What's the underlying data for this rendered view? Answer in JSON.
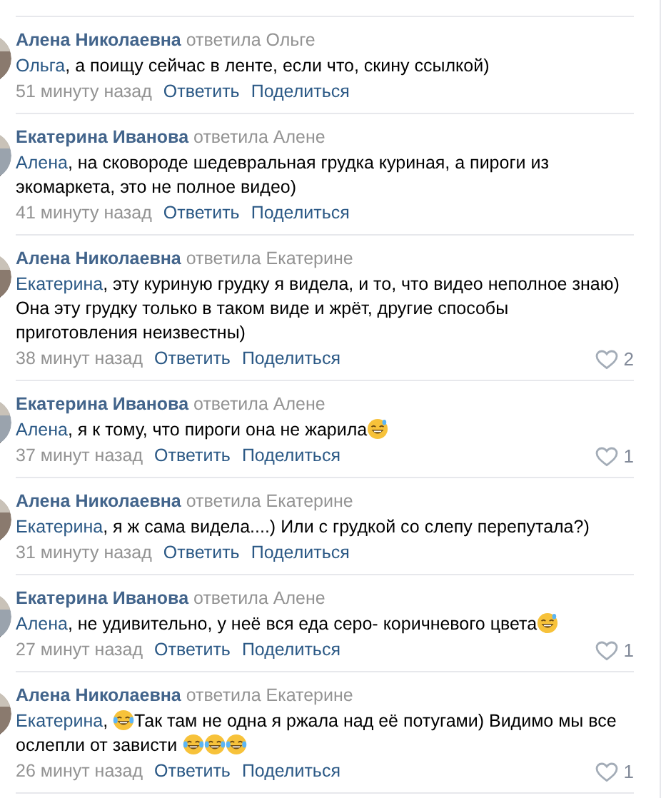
{
  "comments": [
    {
      "author": "Алена Николаевна",
      "reply_to": "ответила Ольге",
      "parts": [
        {
          "kind": "mention",
          "text": "Ольга"
        },
        {
          "kind": "text",
          "text": ", а поищу сейчас в ленте, если что, скину ссылкой)"
        }
      ],
      "time": "51 минуту назад",
      "reply": "Ответить",
      "share": "Поделиться"
    },
    {
      "author": "Екатерина Иванова",
      "reply_to": "ответила Алене",
      "parts": [
        {
          "kind": "mention",
          "text": "Алена"
        },
        {
          "kind": "text",
          "text": ", на сковороде шедевральная грудка куриная, а пироги из экомаркета, это не полное видео)"
        }
      ],
      "time": "41 минуту назад",
      "reply": "Ответить",
      "share": "Поделиться"
    },
    {
      "author": "Алена Николаевна",
      "reply_to": "ответила Екатерине",
      "parts": [
        {
          "kind": "mention",
          "text": "Екатерина"
        },
        {
          "kind": "text",
          "text": ", эту куриную грудку я видела, и то, что видео неполное знаю) Она эту грудку только в таком виде и жрёт, другие способы приготовления неизвестны)"
        }
      ],
      "time": "38 минут назад",
      "reply": "Ответить",
      "share": "Поделиться",
      "likes": "2"
    },
    {
      "author": "Екатерина Иванова",
      "reply_to": "ответила Алене",
      "parts": [
        {
          "kind": "mention",
          "text": "Алена"
        },
        {
          "kind": "text",
          "text": ", я к тому, что пироги она не жарила"
        },
        {
          "kind": "sweat_smile"
        }
      ],
      "time": "37 минут назад",
      "reply": "Ответить",
      "share": "Поделиться",
      "likes": "1"
    },
    {
      "author": "Алена Николаевна",
      "reply_to": "ответила Екатерине",
      "parts": [
        {
          "kind": "mention",
          "text": "Екатерина"
        },
        {
          "kind": "text",
          "text": ", я ж сама видела....) Или с грудкой со слепу перепутала?)"
        }
      ],
      "time": "31 минуту назад",
      "reply": "Ответить",
      "share": "Поделиться"
    },
    {
      "author": "Екатерина Иванова",
      "reply_to": "ответила Алене",
      "parts": [
        {
          "kind": "mention",
          "text": "Алена"
        },
        {
          "kind": "text",
          "text": ", не удивительно, у неё вся еда серо- коричневого цвета"
        },
        {
          "kind": "sweat_smile"
        }
      ],
      "time": "27 минут назад",
      "reply": "Ответить",
      "share": "Поделиться",
      "likes": "1"
    },
    {
      "author": "Алена Николаевна",
      "reply_to": "ответила Екатерине",
      "parts": [
        {
          "kind": "mention",
          "text": "Екатерина"
        },
        {
          "kind": "text",
          "text": ", "
        },
        {
          "kind": "tears_of_joy"
        },
        {
          "kind": "text",
          "text": "Так там не одна я ржала над её потугами) Видимо мы все ослепли от зависти "
        },
        {
          "kind": "tears_of_joy"
        },
        {
          "kind": "tears_of_joy"
        },
        {
          "kind": "tears_of_joy"
        }
      ],
      "time": "26 минут назад",
      "reply": "Ответить",
      "share": "Поделиться",
      "likes": "1"
    }
  ]
}
